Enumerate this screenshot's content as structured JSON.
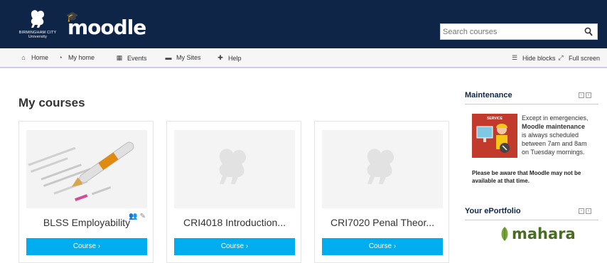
{
  "header": {
    "university_line1": "BIRMINGHAM CITY",
    "university_line2": "University",
    "moodle_logo": "moodle",
    "search_placeholder": "Search courses"
  },
  "nav": {
    "left": [
      {
        "icon": "home-icon",
        "label": "Home"
      },
      {
        "icon": "dashboard-icon",
        "label": "My home"
      },
      {
        "icon": "calendar-icon",
        "label": "Events"
      },
      {
        "icon": "briefcase-icon",
        "label": "My Sites"
      },
      {
        "icon": "lifering-icon",
        "label": "Help"
      }
    ],
    "hide_blocks": "Hide blocks",
    "full_screen": "Full screen"
  },
  "main": {
    "title": "My courses",
    "courses": [
      {
        "title": "BLSS Employability",
        "button": "Course ›"
      },
      {
        "title": "CRI4018 Introduction...",
        "button": "Course ›"
      },
      {
        "title": "CRI7020 Penal Theor...",
        "button": "Course ›"
      }
    ]
  },
  "blocks": {
    "maintenance": {
      "title": "Maintenance",
      "badge": "SERVICE",
      "text_1": "Except in emergencies,",
      "text_2": "Moodle maintenance",
      "text_3": "is always scheduled",
      "text_4": "between 7am and 8am",
      "text_5": "on Tuesday mornings.",
      "note": "Please be aware that Moodle may not be available at that time."
    },
    "eportfolio": {
      "title": "Your ePortfolio",
      "logo_text": "mahara"
    }
  }
}
